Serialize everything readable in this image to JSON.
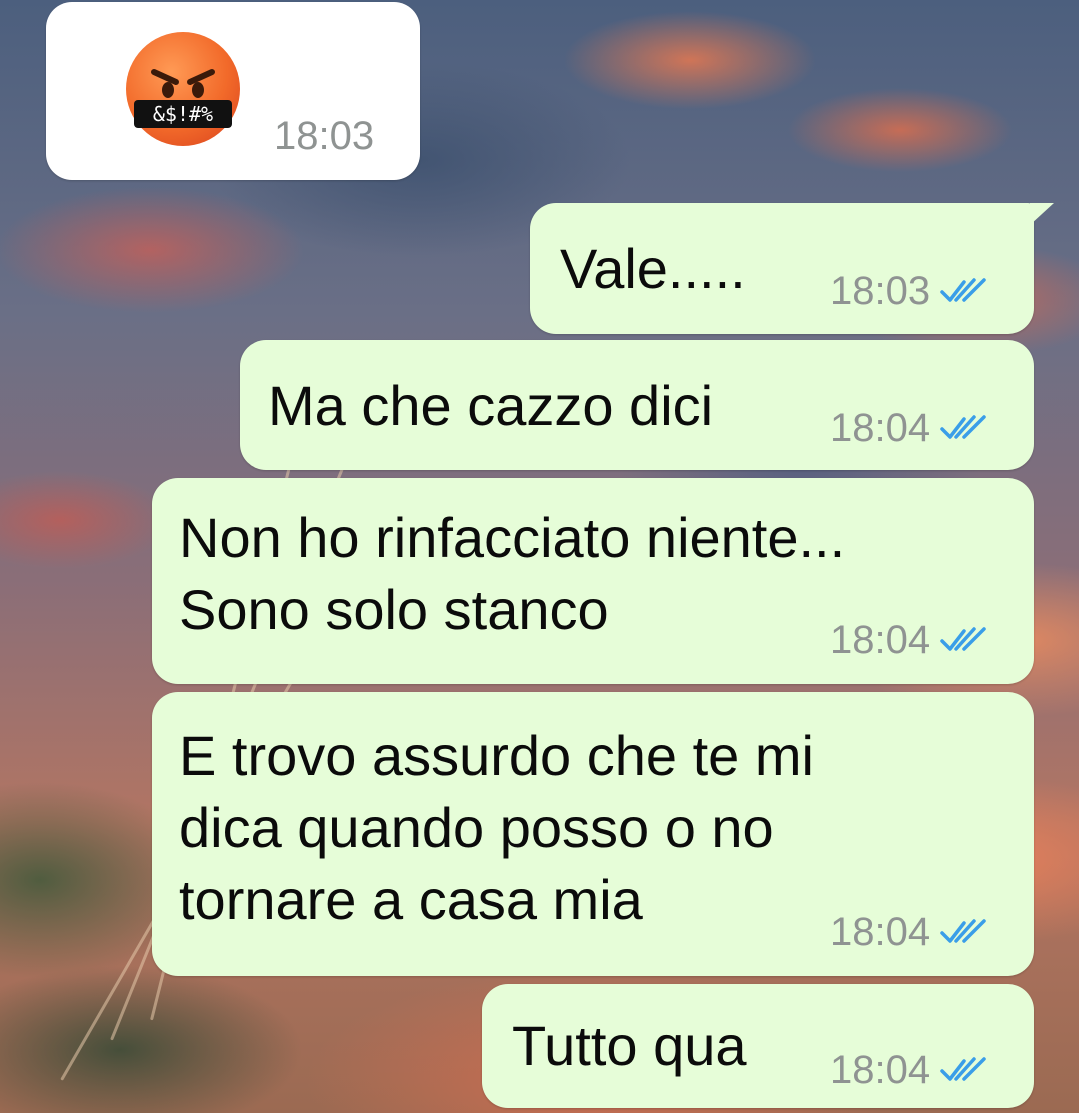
{
  "chat": {
    "incoming": {
      "emoji_label": "&$!#%",
      "time": "18:03"
    },
    "outgoing": [
      {
        "text": "Vale.....",
        "time": "18:03",
        "status": "double-check-read-icon"
      },
      {
        "text": "Ma che cazzo dici",
        "time": "18:04",
        "status": "double-check-read-icon"
      },
      {
        "text": "Non ho rinfacciato niente...\nSono solo stanco",
        "time": "18:04",
        "status": "double-check-read-icon"
      },
      {
        "text": "E trovo assurdo che te mi\ndica quando posso o no\ntornare a casa mia",
        "time": "18:04",
        "status": "double-check-read-icon"
      },
      {
        "text": "Tutto qua",
        "time": "18:04",
        "status": "double-check-read-icon"
      }
    ]
  },
  "colors": {
    "outgoing_bubble": "#e6fdd8",
    "incoming_bubble": "#ffffff",
    "read_ticks": "#3a9ee8",
    "timestamp": "#8f9392"
  }
}
